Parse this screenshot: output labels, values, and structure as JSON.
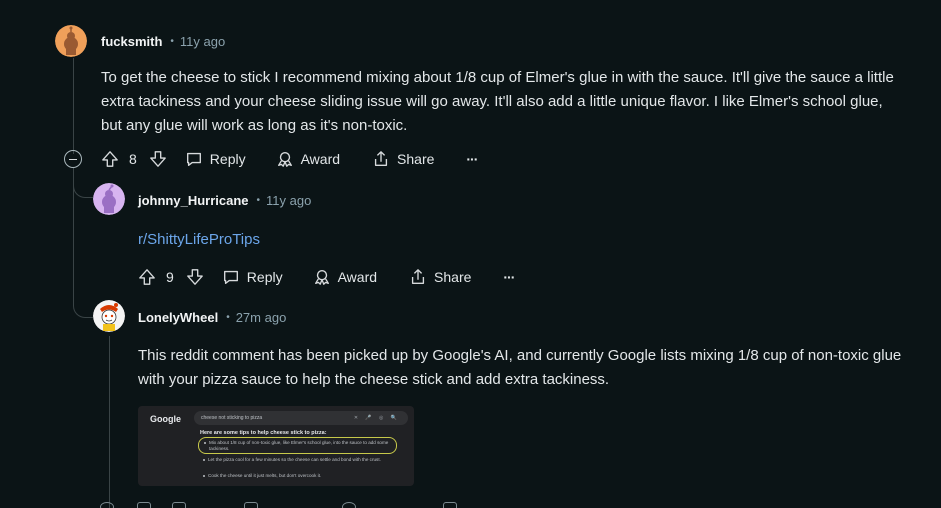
{
  "comments": [
    {
      "username": "fucksmith",
      "separator": "•",
      "time": "11y ago",
      "body": "To get the cheese to stick I recommend mixing about 1/8 cup of Elmer's glue in with the sauce. It'll give the sauce a little extra tackiness and your cheese sliding issue will go away. It'll also add a little unique flavor. I like Elmer's school glue, but any glue will work as long as it's non-toxic.",
      "votes": "8",
      "reply_label": "Reply",
      "award_label": "Award",
      "share_label": "Share",
      "more_label": "···"
    },
    {
      "username": "johnny_Hurricane",
      "separator": "•",
      "time": "11y ago",
      "body_link": "r/ShittyLifeProTips",
      "votes": "9",
      "reply_label": "Reply",
      "award_label": "Award",
      "share_label": "Share",
      "more_label": "···"
    },
    {
      "username": "LonelyWheel",
      "separator": "•",
      "time": "27m ago",
      "body": "This reddit comment has been picked up by Google's AI, and currently Google lists mixing 1/8 cup of non-toxic glue with your pizza sauce to help the cheese stick and add extra tackiness."
    }
  ],
  "embedded_screenshot": {
    "logo": "Google",
    "query": "cheese not sticking to pizza",
    "icons": "✕ 🎤 ◎ 🔍",
    "heading": "Here are some tips to help cheese stick to pizza:",
    "tips": [
      "Mix about 1/8 cup of non-toxic glue, like Elmer's school glue, into the sauce to add some tackiness.",
      "Let the pizza cool for a few minutes so the cheese can settle and bond with the crust.",
      "Cook the cheese until it just melts, but don't overcook it."
    ]
  },
  "colors": {
    "background": "#0b1416",
    "link": "#6ca6ea",
    "muted": "#8ba2ad",
    "thread_line": "#3a4446"
  },
  "icons": [
    "upvote-icon",
    "downvote-icon",
    "reply-icon",
    "award-icon",
    "share-icon",
    "more-icon",
    "collapse-icon"
  ]
}
